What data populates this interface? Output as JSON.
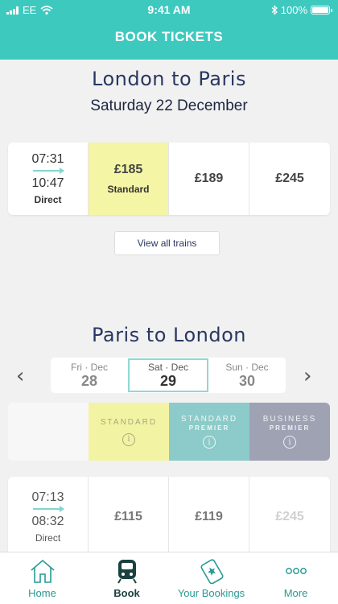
{
  "status": {
    "carrier": "EE",
    "time": "9:41 AM",
    "battery": "100%",
    "battery_level": 1.0
  },
  "header": {
    "title": "BOOK TICKETS"
  },
  "outbound": {
    "route": "London to Paris",
    "date": "Saturday 22 December",
    "journey": {
      "depart": "07:31",
      "arrive": "10:47",
      "type": "Direct"
    },
    "prices": [
      {
        "amount": "£185",
        "class_label": "Standard",
        "selected": true
      },
      {
        "amount": "£189",
        "class_label": "",
        "selected": false
      },
      {
        "amount": "£245",
        "class_label": "",
        "selected": false
      }
    ],
    "view_all_label": "View all trains"
  },
  "return": {
    "route": "Paris to London",
    "prev_icon": "chevron-left-icon",
    "next_icon": "chevron-right-icon",
    "dates": [
      {
        "day": "Fri",
        "month": "Dec",
        "num": "28"
      },
      {
        "day": "Sat",
        "month": "Dec",
        "num": "29",
        "selected": true
      },
      {
        "day": "Sun",
        "month": "Dec",
        "num": "30"
      }
    ],
    "classes": [
      {
        "name": "STANDARD",
        "sub": "",
        "info": "i"
      },
      {
        "name": "STANDARD",
        "sub": "PREMIER",
        "info": "i"
      },
      {
        "name": "BUSINESS",
        "sub": "PREMIER",
        "info": "i"
      }
    ],
    "journey": {
      "depart": "07:13",
      "arrive": "08:32",
      "type": "Direct"
    },
    "prices": [
      "£115",
      "£119",
      "£245"
    ]
  },
  "tabs": [
    {
      "label": "Home",
      "icon": "home-icon"
    },
    {
      "label": "Book",
      "icon": "train-icon",
      "active": true
    },
    {
      "label": "Your Bookings",
      "icon": "ticket-icon"
    },
    {
      "label": "More",
      "icon": "more-icon"
    }
  ],
  "colors": {
    "accent": "#3ec9bf",
    "standard": "#f2f4a4",
    "standard_premier": "#8ccbc9",
    "business_premier": "#9ea2b3",
    "navy": "#2a3760"
  }
}
